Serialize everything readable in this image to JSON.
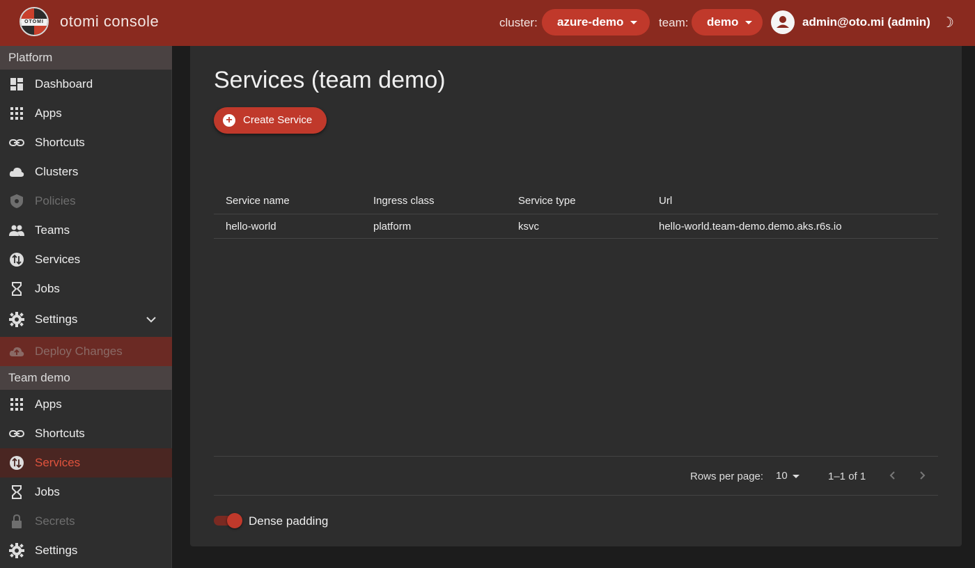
{
  "header": {
    "logo_text": "OTOMI",
    "app_title": "otomi console",
    "cluster_label": "cluster:",
    "cluster_value": "azure-demo",
    "team_label": "team:",
    "team_value": "demo",
    "user": "admin@oto.mi (admin)",
    "theme_icon": "moon-icon",
    "brand_color": "#8a2a1f",
    "accent_color": "#c0392b"
  },
  "sidebar": {
    "platform_title": "Platform",
    "platform_items": [
      {
        "label": "Dashboard",
        "icon": "dashboard-icon"
      },
      {
        "label": "Apps",
        "icon": "apps-grid-icon"
      },
      {
        "label": "Shortcuts",
        "icon": "link-icon"
      },
      {
        "label": "Clusters",
        "icon": "cloud-icon"
      },
      {
        "label": "Policies",
        "icon": "policy-shield-icon",
        "disabled": true
      },
      {
        "label": "Teams",
        "icon": "people-icon"
      },
      {
        "label": "Services",
        "icon": "swap-icon"
      },
      {
        "label": "Jobs",
        "icon": "hourglass-icon"
      },
      {
        "label": "Settings",
        "icon": "gear-icon",
        "expandable": true
      }
    ],
    "deploy_label": "Deploy Changes",
    "team_title": "Team demo",
    "team_items": [
      {
        "label": "Apps",
        "icon": "apps-grid-icon"
      },
      {
        "label": "Shortcuts",
        "icon": "link-icon"
      },
      {
        "label": "Services",
        "icon": "swap-icon",
        "active": true
      },
      {
        "label": "Jobs",
        "icon": "hourglass-icon"
      },
      {
        "label": "Secrets",
        "icon": "lock-icon",
        "disabled": true
      },
      {
        "label": "Settings",
        "icon": "gear-icon"
      }
    ]
  },
  "main": {
    "title": "Services (team demo)",
    "create_button": "Create Service",
    "table": {
      "headers": [
        "Service name",
        "Ingress class",
        "Service type",
        "Url"
      ],
      "rows": [
        [
          "hello-world",
          "platform",
          "ksvc",
          "hello-world.team-demo.demo.aks.r6s.io"
        ]
      ]
    },
    "pagination": {
      "rows_per_page_label": "Rows per page:",
      "rows_per_page_value": "10",
      "range": "1–1 of 1"
    },
    "dense_padding_label": "Dense padding",
    "dense_padding_on": true
  }
}
